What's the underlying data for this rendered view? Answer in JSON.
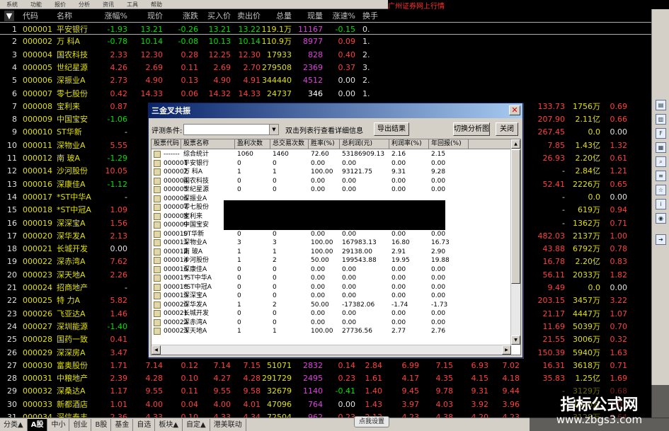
{
  "menubar": [
    "系统",
    "功能",
    "报价",
    "分析",
    "资讯",
    "工具",
    "帮助"
  ],
  "window_title": "广州证券网上行情",
  "colors": {
    "up": "#ff4040",
    "down": "#00e000",
    "flat": "#e0e0e0",
    "code": "#e0e000",
    "name": "#e0e000",
    "vol": "#e0e000",
    "now_vol": "#e040e0",
    "header": "#c0c0c0",
    "dialog_title": "#0a246a",
    "accent": "#0000ff"
  },
  "columns": {
    "sort_icon": "▼",
    "code": "代码",
    "name": "名称",
    "change_pct": "涨幅%",
    "price": "现价",
    "change": "涨跌",
    "bid": "买入价",
    "ask": "卖出价",
    "volume": "总量",
    "now_volume": "现量",
    "speed": "涨速%",
    "turnover": "换手"
  },
  "rows": [
    {
      "n": "1",
      "code": "000001",
      "name": "平安银行",
      "pct": "-1.93",
      "price": "13.21",
      "chg": "-0.26",
      "bid": "13.21",
      "ask": "13.22",
      "vol": "119.1万",
      "now": "11167",
      "spd": "-0.15",
      "to": "0.",
      "dir": "down"
    },
    {
      "n": "2",
      "code": "000002",
      "name": "万  科A",
      "pct": "-0.78",
      "price": "10.14",
      "chg": "-0.08",
      "bid": "10.13",
      "ask": "10.14",
      "vol": "110.9万",
      "now": "8977",
      "spd": "0.09",
      "to": "1.",
      "dir": "down"
    },
    {
      "n": "3",
      "code": "000004",
      "name": "国农科技",
      "pct": "2.33",
      "price": "12.30",
      "chg": "0.28",
      "bid": "12.25",
      "ask": "12.30",
      "vol": "17933",
      "now": "828",
      "spd": "0.40",
      "to": "2.",
      "dir": "up"
    },
    {
      "n": "4",
      "code": "000005",
      "name": "世纪星源",
      "pct": "4.26",
      "price": "2.69",
      "chg": "0.11",
      "bid": "2.69",
      "ask": "2.70",
      "vol": "279508",
      "now": "2369",
      "spd": "0.37",
      "to": "3.",
      "dir": "up"
    },
    {
      "n": "5",
      "code": "000006",
      "name": "深振业A",
      "pct": "2.73",
      "price": "4.90",
      "chg": "0.13",
      "bid": "4.90",
      "ask": "4.91",
      "vol": "344440",
      "now": "4512",
      "spd": "0.00",
      "to": "2.",
      "dir": "up"
    },
    {
      "n": "6",
      "code": "000007",
      "name": "零七股份",
      "pct": "0.42",
      "price": "14.33",
      "chg": "0.06",
      "bid": "14.32",
      "ask": "14.33",
      "vol": "24737",
      "now": "346",
      "spd": "0.00",
      "to": "1.",
      "dir": "up"
    },
    {
      "n": "7",
      "code": "000008",
      "name": "宝利来",
      "pct": "0.87",
      "extra": [
        "133.73",
        "1756万",
        "0.69"
      ]
    },
    {
      "n": "8",
      "code": "000009",
      "name": "中国宝安",
      "pct": "-1.06",
      "extra": [
        "207.90",
        "2.11亿",
        "0.66"
      ]
    },
    {
      "n": "9",
      "code": "000010",
      "name": "ST华新",
      "pct": "-",
      "extra": [
        "267.45",
        "0.0",
        "0.00"
      ]
    },
    {
      "n": "10",
      "code": "000011",
      "name": "深物业A",
      "pct": "5.55",
      "extra": [
        "7.85",
        "1.43亿",
        "1.32"
      ]
    },
    {
      "n": "11",
      "code": "000012",
      "name": "南  玻A",
      "pct": "-1.29",
      "extra": [
        "26.93",
        "2.20亿",
        "0.61"
      ]
    },
    {
      "n": "12",
      "code": "000014",
      "name": "沙河股份",
      "pct": "10.05",
      "extra": [
        "-",
        "2.84亿",
        "1.21"
      ]
    },
    {
      "n": "13",
      "code": "000016",
      "name": "深康佳A",
      "pct": "-1.12",
      "extra": [
        "52.41",
        "2226万",
        "0.65"
      ]
    },
    {
      "n": "14",
      "code": "000017",
      "name": "*ST中华A",
      "pct": "-",
      "extra": [
        "-",
        "0.0",
        "0.00"
      ]
    },
    {
      "n": "15",
      "code": "000018",
      "name": "*ST中冠A",
      "pct": "1.09",
      "extra": [
        "-",
        "619万",
        "0.94"
      ]
    },
    {
      "n": "16",
      "code": "000019",
      "name": "深深宝A",
      "pct": "1.56",
      "extra": [
        "-",
        "1362万",
        "0.71"
      ]
    },
    {
      "n": "17",
      "code": "000020",
      "name": "深华发A",
      "pct": "2.13",
      "extra": [
        "482.03",
        "2137万",
        "1.00"
      ]
    },
    {
      "n": "18",
      "code": "000021",
      "name": "长城开发",
      "pct": "0.00",
      "extra": [
        "43.88",
        "6792万",
        "0.78"
      ]
    },
    {
      "n": "19",
      "code": "000022",
      "name": "深赤湾A",
      "pct": "7.62",
      "extra": [
        "16.78",
        "2.20亿",
        "0.83"
      ]
    },
    {
      "n": "20",
      "code": "000023",
      "name": "深天地A",
      "pct": "2.26",
      "extra": [
        "56.11",
        "2033万",
        "1.82"
      ]
    },
    {
      "n": "21",
      "code": "000024",
      "name": "招商地产",
      "pct": "-",
      "extra": [
        "9.49",
        "0.0",
        "0.00"
      ]
    },
    {
      "n": "22",
      "code": "000025",
      "name": "特  力A",
      "pct": "5.82",
      "extra": [
        "203.15",
        "3457万",
        "3.22"
      ]
    },
    {
      "n": "23",
      "code": "000026",
      "name": "飞亚达A",
      "pct": "1.46",
      "extra": [
        "21.17",
        "4447万",
        "1.07"
      ]
    },
    {
      "n": "24",
      "code": "000027",
      "name": "深圳能源",
      "pct": "-1.40",
      "extra": [
        "11.69",
        "5039万",
        "0.70"
      ]
    },
    {
      "n": "25",
      "code": "000028",
      "name": "国药一致",
      "pct": "0.41",
      "extra": [
        "21.55",
        "3006万",
        "0.32"
      ]
    },
    {
      "n": "26",
      "code": "000029",
      "name": "深深房A",
      "pct": "3.47",
      "extra": [
        "150.39",
        "5940万",
        "1.63"
      ]
    },
    {
      "n": "27",
      "code": "000030",
      "name": "富奥股份",
      "pct": "1.71",
      "tail": [
        "7.14",
        "0.12",
        "7.14",
        "7.15",
        "51071",
        "2832",
        "0.14",
        "2.84",
        "6.99",
        "7.15",
        "6.93",
        "7.02",
        "16.31",
        "3618万",
        "0.71"
      ]
    },
    {
      "n": "28",
      "code": "000031",
      "name": "中粮地产",
      "pct": "2.39",
      "tail": [
        "4.28",
        "0.10",
        "4.27",
        "4.28",
        "291729",
        "2495",
        "0.23",
        "1.61",
        "4.17",
        "4.35",
        "4.15",
        "4.18",
        "35.83",
        "1.25亿",
        "1.69"
      ]
    },
    {
      "n": "29",
      "code": "000032",
      "name": "深桑达A",
      "pct": "1.17",
      "tail": [
        "9.55",
        "0.11",
        "9.55",
        "9.58",
        "32679",
        "1140",
        "-0.41",
        "1.40",
        "9.45",
        "9.78",
        "9.31",
        "9.44",
        "-",
        "3129万",
        "0.68"
      ]
    },
    {
      "n": "30",
      "code": "000033",
      "name": "新都酒店",
      "pct": "1.01",
      "tail": [
        "4.00",
        "0.04",
        "4.00",
        "4.01",
        "47096",
        "764",
        "0.00",
        "1.43",
        "3.97",
        "4.03",
        "3.92",
        "3.96",
        "-",
        "1876万",
        "1.03"
      ]
    },
    {
      "n": "31",
      "code": "000034",
      "name": "深信泰丰",
      "pct": "2.36",
      "tail": [
        "4.33",
        "0.10",
        "4.33",
        "4.34",
        "72504",
        "962",
        "0.23",
        "2.13",
        "4.23",
        "4.38",
        "4.20",
        "4.23",
        "-",
        "3128万",
        "0.64"
      ]
    }
  ],
  "bottom_tabs": [
    "分类▲",
    "A股",
    "中小",
    "创业",
    "B股",
    "基金",
    "自选",
    "板块▲",
    "自定▲",
    "港美联动"
  ],
  "point_settings": "点我设置",
  "watermark": {
    "line1": "指标公式网",
    "line2": "www.zbgs3.com"
  },
  "dialog": {
    "title": "三金叉共振",
    "close": "✕",
    "eval_label": "评测条件:",
    "hint": "双击列表行查看详细信息",
    "export_btn": "导出结果",
    "switch_btn": "切换分析图",
    "close_btn": "关闭",
    "headers": [
      "股票代码",
      "股票名称",
      "盈利次数",
      "总交易次数",
      "胜率(%)",
      "总利润(元)",
      "利润率(%)",
      "年回报(%)"
    ],
    "rows": [
      [
        "-------",
        "综合统计",
        "1060",
        "1460",
        "72.60",
        "53186909.13",
        "2.16",
        "2.15"
      ],
      [
        "000001",
        "平安银行",
        "0",
        "0",
        "0.00",
        "0.00",
        "0.00",
        "0.00"
      ],
      [
        "000002",
        "万  科A",
        "1",
        "1",
        "100.00",
        "93121.75",
        "9.31",
        "9.28"
      ],
      [
        "000004",
        "国农科技",
        "0",
        "0",
        "0.00",
        "0.00",
        "0.00",
        "0.00"
      ],
      [
        "000005",
        "世纪星源",
        "0",
        "0",
        "0.00",
        "0.00",
        "0.00",
        "0.00"
      ],
      [
        "000006",
        "深振业A",
        "",
        "",
        "",
        "",
        "",
        ""
      ],
      [
        "000007",
        "零七股份",
        "",
        "",
        "",
        "",
        "",
        ""
      ],
      [
        "000008",
        "宝利来",
        "",
        "",
        "",
        "",
        "",
        ""
      ],
      [
        "000009",
        "中国宝安",
        "1",
        "1",
        "100.00",
        "14369.69",
        "1.44",
        "1.43"
      ],
      [
        "000010",
        "ST华新",
        "0",
        "0",
        "0.00",
        "0.00",
        "0.00",
        "0.00"
      ],
      [
        "000011",
        "深物业A",
        "3",
        "3",
        "100.00",
        "167983.13",
        "16.80",
        "16.73"
      ],
      [
        "000012",
        "南  玻A",
        "1",
        "1",
        "100.00",
        "29138.00",
        "2.91",
        "2.90"
      ],
      [
        "000014",
        "沙河股份",
        "1",
        "2",
        "50.00",
        "199543.88",
        "19.95",
        "19.88"
      ],
      [
        "000016",
        "深康佳A",
        "0",
        "0",
        "0.00",
        "0.00",
        "0.00",
        "0.00"
      ],
      [
        "000017",
        "*ST中华A",
        "0",
        "0",
        "0.00",
        "0.00",
        "0.00",
        "0.00"
      ],
      [
        "000018",
        "*ST中冠A",
        "0",
        "0",
        "0.00",
        "0.00",
        "0.00",
        "0.00"
      ],
      [
        "000019",
        "深深宝A",
        "0",
        "0",
        "0.00",
        "0.00",
        "0.00",
        "0.00"
      ],
      [
        "000020",
        "深华发A",
        "1",
        "2",
        "50.00",
        "-17382.06",
        "-1.74",
        "-1.73"
      ],
      [
        "000021",
        "长城开发",
        "0",
        "0",
        "0.00",
        "0.00",
        "0.00",
        "0.00"
      ],
      [
        "000022",
        "深赤湾A",
        "0",
        "0",
        "0.00",
        "0.00",
        "0.00",
        "0.00"
      ],
      [
        "000023",
        "深天地A",
        "1",
        "1",
        "100.00",
        "27736.56",
        "2.77",
        "2.76"
      ]
    ]
  }
}
